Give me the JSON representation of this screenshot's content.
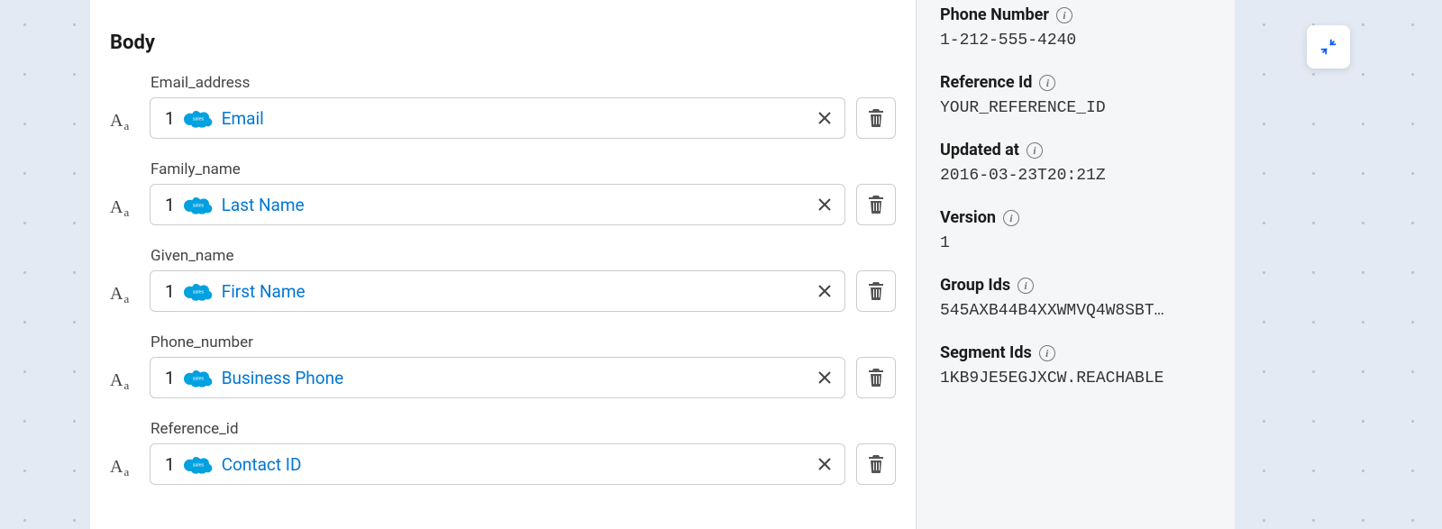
{
  "body": {
    "title": "Body",
    "rows": [
      {
        "label": "Email_address",
        "seq": "1",
        "value": "Email"
      },
      {
        "label": "Family_name",
        "seq": "1",
        "value": "Last Name"
      },
      {
        "label": "Given_name",
        "seq": "1",
        "value": "First Name"
      },
      {
        "label": "Phone_number",
        "seq": "1",
        "value": "Business Phone"
      },
      {
        "label": "Reference_id",
        "seq": "1",
        "value": "Contact ID"
      }
    ]
  },
  "meta": {
    "phone_number": {
      "label": "Phone Number",
      "value": "1-212-555-4240"
    },
    "reference_id": {
      "label": "Reference Id",
      "value": "YOUR_REFERENCE_ID"
    },
    "updated_at": {
      "label": "Updated at",
      "value": "2016-03-23T20:21Z"
    },
    "version": {
      "label": "Version",
      "value": "1"
    },
    "group_ids": {
      "label": "Group Ids",
      "value": "545AXB44B4XXWMVQ4W8SBT…"
    },
    "segment_ids": {
      "label": "Segment Ids",
      "value": "1KB9JE5EGJXCW.REACHABLE"
    }
  }
}
